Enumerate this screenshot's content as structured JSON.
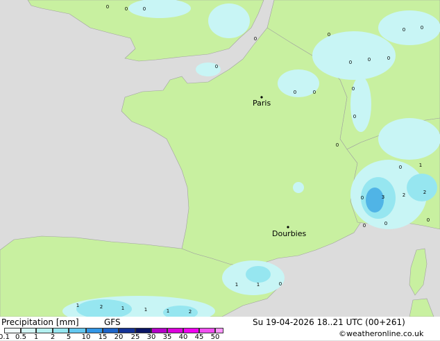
{
  "map": {
    "cities": [
      {
        "name": "Paris"
      },
      {
        "name": "Dourbies"
      }
    ],
    "values_north": [
      "0",
      "0",
      "0",
      "0",
      "0",
      "0",
      "0",
      "0",
      "0",
      "0",
      "0",
      "0",
      "0"
    ],
    "values_east": [
      "0",
      "0",
      "0",
      "1",
      "0",
      "3",
      "2",
      "2",
      "0",
      "0",
      "0",
      "0"
    ],
    "values_south": [
      "1",
      "1",
      "0",
      "1",
      "2",
      "1",
      "1",
      "1",
      "2"
    ],
    "colors": {
      "sea": "#dcdcdc",
      "land": "#c8f0a0",
      "precip_light": "#c8f5f5",
      "precip_mid": "#96e6f0",
      "precip_high": "#50b4e6",
      "border": "#a0a0a0"
    }
  },
  "legend": {
    "title": "Precipitation [mm]",
    "model": "GFS",
    "ticks": [
      "0.1",
      "0.5",
      "1",
      "2",
      "5",
      "10",
      "15",
      "20",
      "25",
      "30",
      "35",
      "40",
      "45",
      "50"
    ],
    "colors": [
      "#f0fafa",
      "#d2f5f5",
      "#b4f0f0",
      "#96e6f0",
      "#64c8f0",
      "#3296e6",
      "#1e64c8",
      "#143296",
      "#0a1464",
      "#b400c8",
      "#dc00dc",
      "#f000f0",
      "#f050f0",
      "#ff96ff"
    ]
  },
  "footer": {
    "datetime": "Su 19-04-2026 18..21 UTC (00+261)",
    "credit": "©weatheronline.co.uk"
  }
}
